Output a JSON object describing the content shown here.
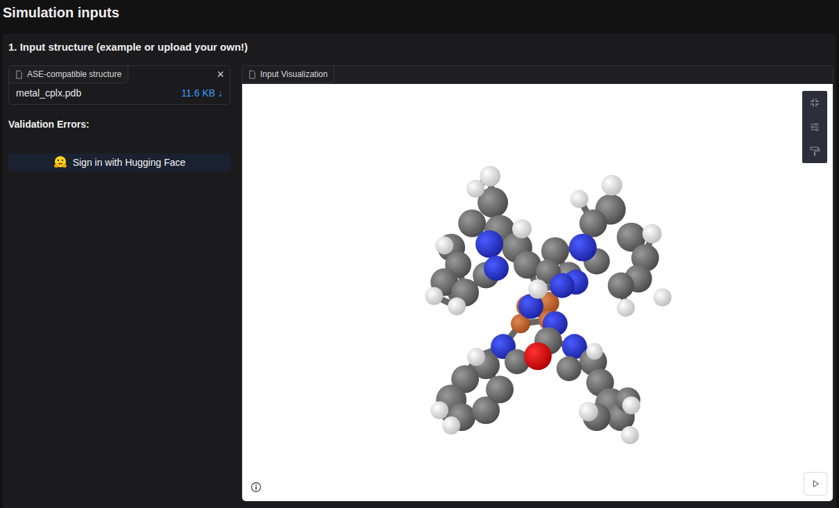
{
  "page_title": "Simulation inputs",
  "section": {
    "title": "1. Input structure (example or upload your own!)"
  },
  "file_input": {
    "label": "ASE-compatible structure",
    "close": "×",
    "file": {
      "name": "metal_cplx.pdb",
      "size": "11.6 KB ↓"
    }
  },
  "validation": {
    "label": "Validation Errors:"
  },
  "signin_button": {
    "label": "Sign in with Hugging Face"
  },
  "viewer": {
    "label": "Input Visualization"
  }
}
